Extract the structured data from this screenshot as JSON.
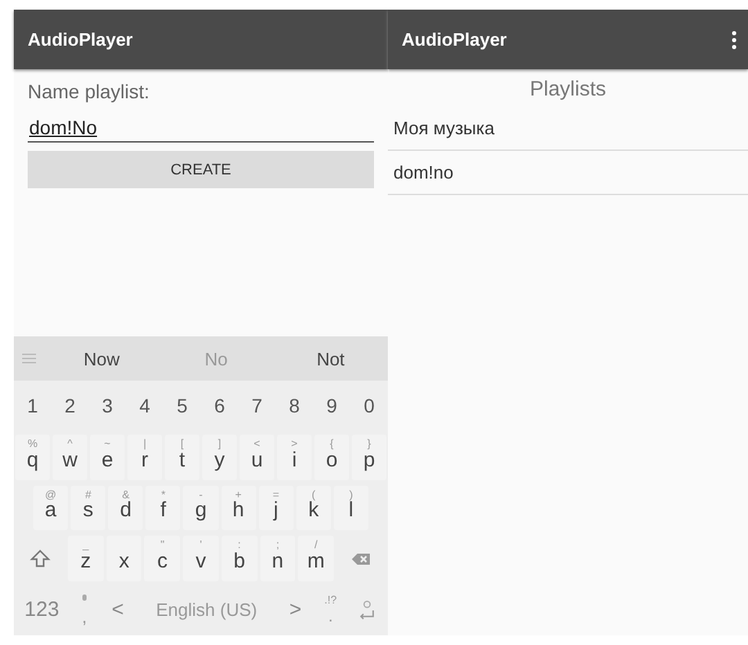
{
  "left_screen": {
    "app_bar": {
      "title": "AudioPlayer"
    },
    "label": "Name playlist:",
    "name_field": {
      "value": "dom!No"
    },
    "create_button": "CREATE",
    "keyboard": {
      "suggestions": [
        {
          "text": "Now",
          "selected": true
        },
        {
          "text": "No",
          "selected": false
        },
        {
          "text": "Not",
          "selected": true
        }
      ],
      "number_row": [
        "1",
        "2",
        "3",
        "4",
        "5",
        "6",
        "7",
        "8",
        "9",
        "0"
      ],
      "letter_rows": [
        [
          {
            "kind": "char",
            "label": "q",
            "hint": "%"
          },
          {
            "kind": "char",
            "label": "w",
            "hint": "^"
          },
          {
            "kind": "char",
            "label": "e",
            "hint": "~"
          },
          {
            "kind": "char",
            "label": "r",
            "hint": "|"
          },
          {
            "kind": "char",
            "label": "t",
            "hint": "["
          },
          {
            "kind": "char",
            "label": "y",
            "hint": "]"
          },
          {
            "kind": "char",
            "label": "u",
            "hint": "<"
          },
          {
            "kind": "char",
            "label": "i",
            "hint": ">"
          },
          {
            "kind": "char",
            "label": "o",
            "hint": "{"
          },
          {
            "kind": "char",
            "label": "p",
            "hint": "}"
          }
        ],
        [
          {
            "kind": "char",
            "label": "a",
            "hint": "@"
          },
          {
            "kind": "char",
            "label": "s",
            "hint": "#"
          },
          {
            "kind": "char",
            "label": "d",
            "hint": "&"
          },
          {
            "kind": "char",
            "label": "f",
            "hint": "*"
          },
          {
            "kind": "char",
            "label": "g",
            "hint": "-"
          },
          {
            "kind": "char",
            "label": "h",
            "hint": "+"
          },
          {
            "kind": "char",
            "label": "j",
            "hint": "="
          },
          {
            "kind": "char",
            "label": "k",
            "hint": "("
          },
          {
            "kind": "char",
            "label": "l",
            "hint": ")"
          }
        ],
        [
          {
            "kind": "shift"
          },
          {
            "kind": "char",
            "label": "z",
            "hint": "_"
          },
          {
            "kind": "char",
            "label": "x"
          },
          {
            "kind": "char",
            "label": "c",
            "hint": "\""
          },
          {
            "kind": "char",
            "label": "v",
            "hint": "'"
          },
          {
            "kind": "char",
            "label": "b",
            "hint": ":"
          },
          {
            "kind": "char",
            "label": "n",
            "hint": ";"
          },
          {
            "kind": "char",
            "label": "m",
            "hint": "/"
          },
          {
            "kind": "backspace"
          }
        ]
      ],
      "bottom_row": {
        "symbols_key": "123",
        "comma_key": ",",
        "space_bar": "English (US)",
        "left_arrow": "<",
        "right_arrow": ">",
        "period_key": ".",
        "period_hint": ".!?"
      }
    }
  },
  "right_screen": {
    "app_bar": {
      "title": "AudioPlayer"
    },
    "heading": "Playlists",
    "playlists": [
      "Моя музыка",
      "dom!no"
    ]
  }
}
